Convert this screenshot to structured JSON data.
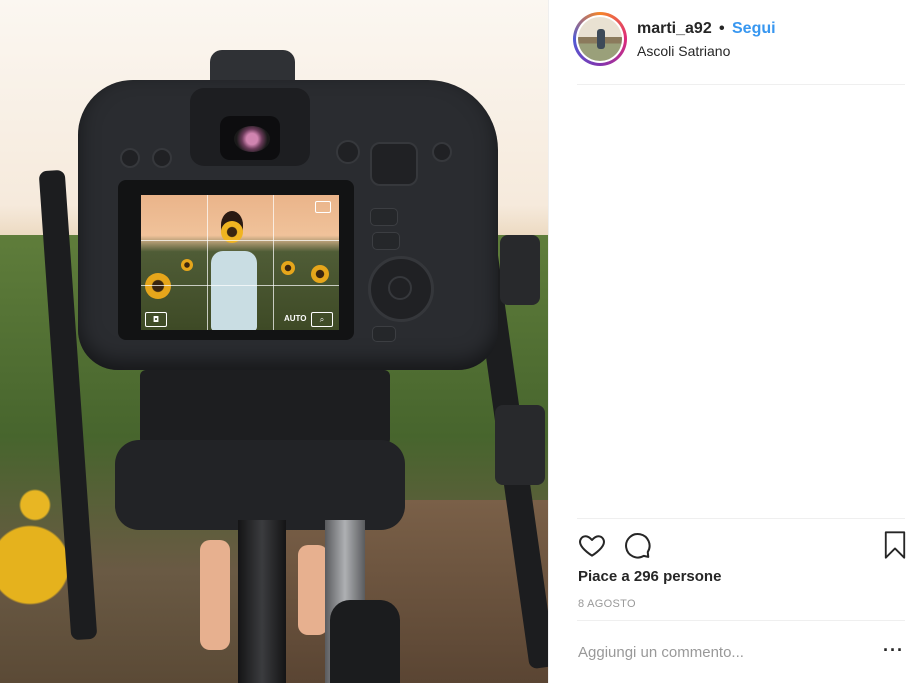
{
  "post": {
    "username": "marti_a92",
    "separator": "•",
    "follow_label": "Segui",
    "location": "Ascoli Satriano",
    "likes_text": "Piace a 296 persone",
    "date": "8 AGOSTO"
  },
  "actions": {
    "like_icon": "heart-outline",
    "comment_icon": "speech-bubble-outline",
    "save_icon": "bookmark-outline",
    "more_label": "···"
  },
  "comment": {
    "placeholder": "Aggiungi un commento..."
  },
  "camera_screen": {
    "mode_label": "AUTO"
  },
  "colors": {
    "follow": "#3897f0",
    "text": "#262626",
    "muted": "#999999",
    "divider": "#efefef"
  }
}
